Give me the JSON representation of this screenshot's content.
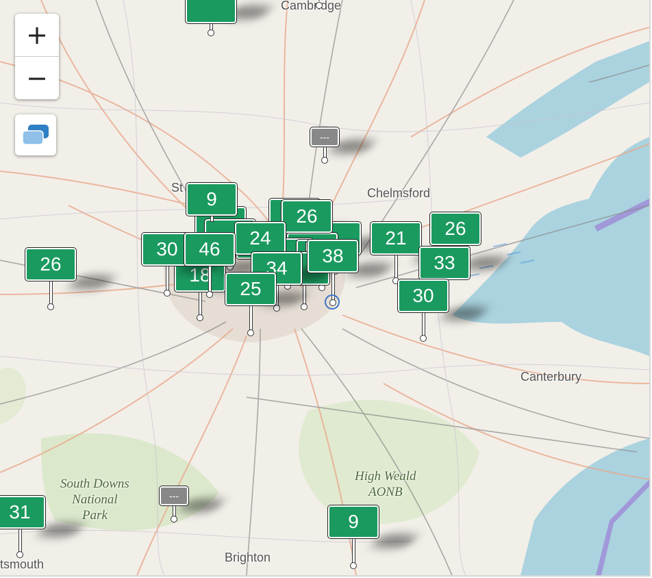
{
  "map": {
    "zoom_in_label": "+",
    "zoom_out_label": "−",
    "layers_icon": "layers-icon",
    "places": {
      "cambridge": "Cambridge",
      "chelmsford": "Chelmsford",
      "canterbury": "Canterbury",
      "brighton": "Brighton",
      "portsmouth": "tsmouth",
      "st": "St",
      "south_downs": "South Downs\nNational\nPark",
      "high_weald": "High Weald\nAONB"
    },
    "markers": {
      "north": "",
      "harlow": "---",
      "st_albans": "9",
      "c1": "",
      "c2": "",
      "c3": "",
      "c4": "",
      "c5": "",
      "c6": "",
      "c7": "",
      "c8": "",
      "enfield": "26",
      "west": "30",
      "hillingdon": "18",
      "ealing": "46",
      "c9": "24",
      "central": "34",
      "c10": "",
      "east": "38",
      "lambeth": "25",
      "reading": "26",
      "southend_a": "21",
      "southend_b": "26",
      "southend_c": "33",
      "medway": "30",
      "horsham": "---",
      "portsmouth": "31",
      "eastbourne": "9"
    }
  }
}
